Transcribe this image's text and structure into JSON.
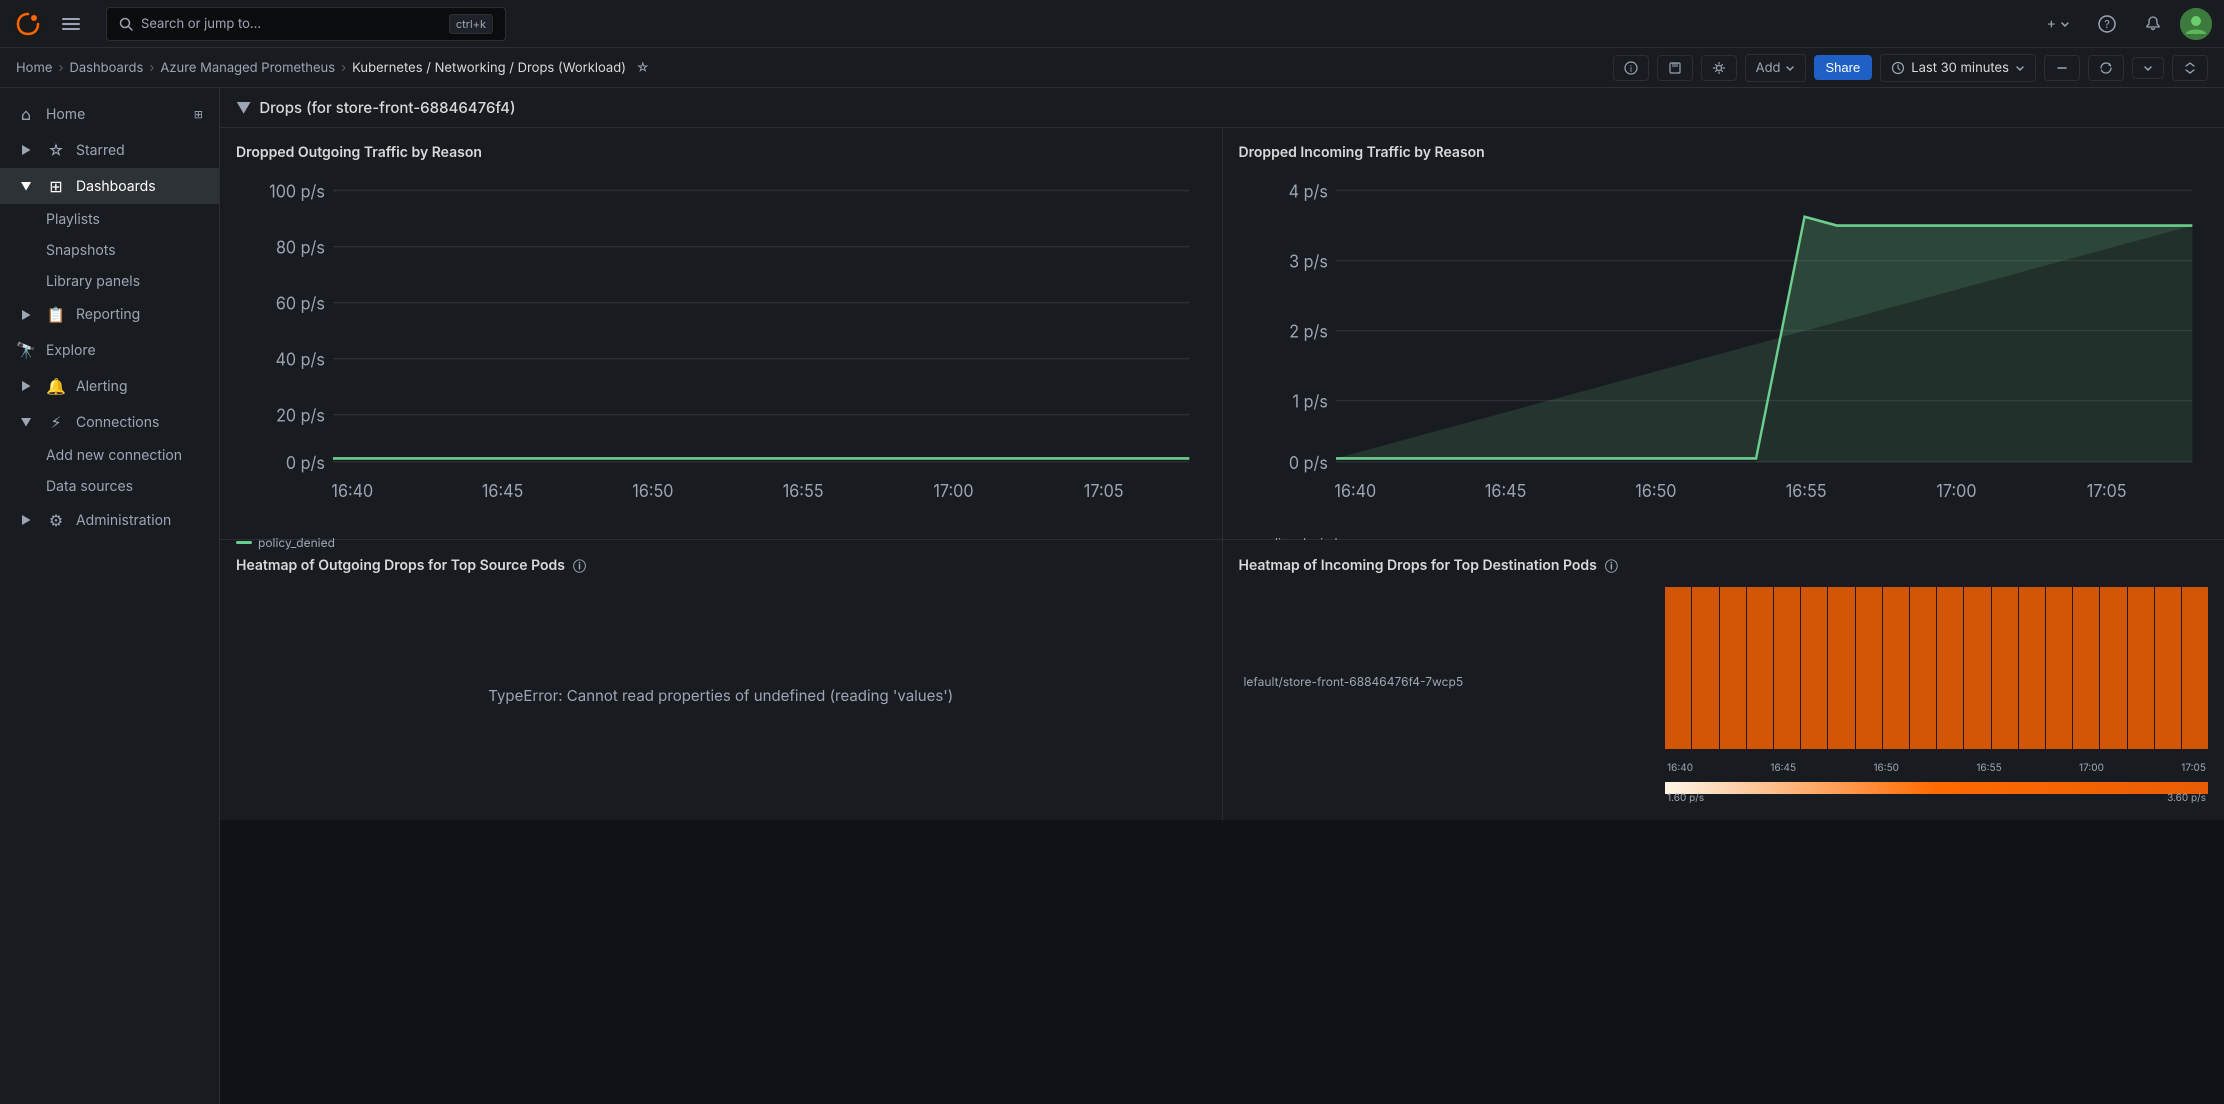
{
  "topnav": {
    "search_placeholder": "Search or jump to...",
    "shortcut": "ctrl+k",
    "add_label": "+",
    "help_icon": "?",
    "notifications_icon": "🔔"
  },
  "breadcrumb": {
    "items": [
      {
        "label": "Home",
        "link": true
      },
      {
        "label": "Dashboards",
        "link": true
      },
      {
        "label": "Azure Managed Prometheus",
        "link": true
      },
      {
        "label": "Kubernetes / Networking / Drops (Workload)",
        "link": false
      }
    ],
    "add_label": "Add",
    "share_label": "Share",
    "time_label": "Last 30 minutes"
  },
  "sidebar": {
    "home_label": "Home",
    "starred_label": "Starred",
    "dashboards_label": "Dashboards",
    "playlists_label": "Playlists",
    "snapshots_label": "Snapshots",
    "library_panels_label": "Library panels",
    "reporting_label": "Reporting",
    "explore_label": "Explore",
    "alerting_label": "Alerting",
    "connections_label": "Connections",
    "add_new_connection_label": "Add new connection",
    "data_sources_label": "Data sources",
    "administration_label": "Administration"
  },
  "section": {
    "title": "Drops (for store-front-68846476f4)"
  },
  "panels": [
    {
      "id": "dropped-outgoing",
      "title": "Dropped Outgoing Traffic by Reason",
      "type": "line",
      "y_labels": [
        "100 p/s",
        "80 p/s",
        "60 p/s",
        "40 p/s",
        "20 p/s",
        "0 p/s"
      ],
      "x_labels": [
        "16:40",
        "16:45",
        "16:50",
        "16:55",
        "17:00",
        "17:05"
      ],
      "legend_color": "#6ccf8e",
      "legend_label": "policy_denied",
      "has_line": true,
      "line_flat": true
    },
    {
      "id": "dropped-incoming",
      "title": "Dropped Incoming Traffic by Reason",
      "type": "line",
      "y_labels": [
        "4 p/s",
        "3 p/s",
        "2 p/s",
        "1 p/s",
        "0 p/s"
      ],
      "x_labels": [
        "16:40",
        "16:45",
        "16:50",
        "16:55",
        "17:00",
        "17:05"
      ],
      "legend_color": "#6ccf8e",
      "legend_label": "policy_denied",
      "has_spike": true
    },
    {
      "id": "heatmap-outgoing",
      "title": "Heatmap of Outgoing Drops for Top Source Pods",
      "type": "heatmap",
      "error": "TypeError: Cannot read properties of undefined (reading 'values')",
      "has_error": true
    },
    {
      "id": "heatmap-incoming",
      "title": "Heatmap of Incoming Drops for Top Destination Pods",
      "type": "heatmap",
      "has_error": false,
      "pod_label": "lefault/store-front-68846476f4-7wcp5",
      "x_labels": [
        "16:40",
        "16:45",
        "16:50",
        "16:55",
        "17:00",
        "17:05"
      ],
      "gradient_min": "1.60 p/s",
      "gradient_max": "3.60 p/s"
    }
  ]
}
